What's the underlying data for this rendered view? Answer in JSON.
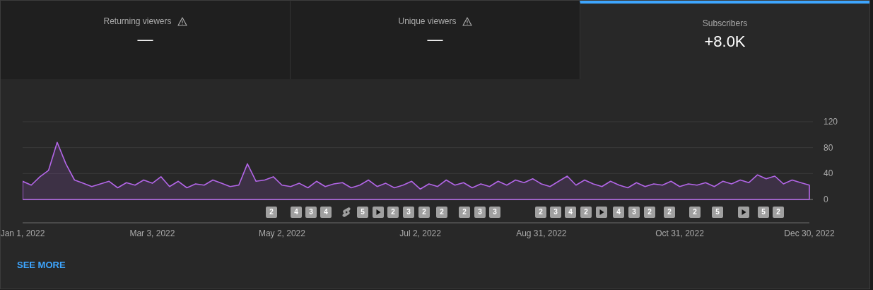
{
  "metric_tabs": [
    {
      "label": "Returning viewers",
      "value": "—",
      "warning": true,
      "selected": false
    },
    {
      "label": "Unique viewers",
      "value": "—",
      "warning": true,
      "selected": false
    },
    {
      "label": "Subscribers",
      "value": "+8.0K",
      "warning": false,
      "selected": true
    }
  ],
  "chart": {
    "chart_data": {
      "type": "area",
      "ylim": [
        0,
        120
      ],
      "yticks": [
        0,
        40,
        80,
        120
      ],
      "categories": [
        "Jan 1, 2022",
        null,
        null,
        null,
        null,
        null,
        null,
        null,
        null,
        null,
        null,
        null,
        null,
        null,
        null,
        "Mar 3, 2022",
        null,
        null,
        null,
        null,
        null,
        null,
        null,
        null,
        null,
        null,
        null,
        null,
        null,
        null,
        "May 2, 2022",
        null,
        null,
        null,
        null,
        null,
        null,
        null,
        null,
        null,
        null,
        null,
        null,
        null,
        null,
        null,
        "Jul 2, 2022",
        null,
        null,
        null,
        null,
        null,
        null,
        null,
        null,
        null,
        null,
        null,
        null,
        null,
        "Aug 31, 2022",
        null,
        null,
        null,
        null,
        null,
        null,
        null,
        null,
        null,
        null,
        null,
        null,
        null,
        null,
        null,
        "Oct 31, 2022",
        null,
        null,
        null,
        null,
        null,
        null,
        null,
        null,
        null,
        null,
        null,
        null,
        null,
        null,
        "Dec 30, 2022"
      ],
      "series": [
        {
          "color": "#b366e8",
          "values": [
            28,
            22,
            35,
            45,
            88,
            55,
            30,
            25,
            20,
            24,
            28,
            18,
            26,
            22,
            30,
            25,
            35,
            20,
            28,
            18,
            24,
            22,
            30,
            25,
            20,
            22,
            55,
            28,
            30,
            35,
            22,
            20,
            25,
            18,
            28,
            20,
            24,
            26,
            18,
            22,
            30,
            20,
            25,
            18,
            22,
            28,
            16,
            24,
            20,
            30,
            22,
            26,
            18,
            24,
            20,
            28,
            22,
            30,
            26,
            32,
            24,
            20,
            28,
            36,
            22,
            30,
            24,
            20,
            28,
            22,
            18,
            26,
            20,
            24,
            22,
            28,
            20,
            24,
            22,
            26,
            20,
            28,
            24,
            30,
            26,
            38,
            32,
            36,
            24,
            30,
            26,
            22
          ]
        }
      ]
    }
  },
  "markers": [
    {
      "kind": "count",
      "label": "2"
    },
    {
      "kind": "count",
      "label": "4"
    },
    {
      "kind": "count",
      "label": "3"
    },
    {
      "kind": "count",
      "label": "4"
    },
    {
      "kind": "short"
    },
    {
      "kind": "count",
      "label": "5"
    },
    {
      "kind": "video"
    },
    {
      "kind": "count",
      "label": "2"
    },
    {
      "kind": "count",
      "label": "3"
    },
    {
      "kind": "count",
      "label": "2"
    },
    {
      "kind": "count",
      "label": "2"
    },
    {
      "kind": "count",
      "label": "2"
    },
    {
      "kind": "count",
      "label": "3"
    },
    {
      "kind": "count",
      "label": "3"
    },
    {
      "kind": "count",
      "label": "2"
    },
    {
      "kind": "count",
      "label": "3"
    },
    {
      "kind": "count",
      "label": "4"
    },
    {
      "kind": "count",
      "label": "2"
    },
    {
      "kind": "video"
    },
    {
      "kind": "count",
      "label": "4"
    },
    {
      "kind": "count",
      "label": "3"
    },
    {
      "kind": "count",
      "label": "2"
    },
    {
      "kind": "count",
      "label": "2"
    },
    {
      "kind": "count",
      "label": "2"
    },
    {
      "kind": "count",
      "label": "5"
    },
    {
      "kind": "video"
    },
    {
      "kind": "count",
      "label": "5"
    },
    {
      "kind": "count",
      "label": "2"
    }
  ],
  "see_more": "SEE MORE"
}
